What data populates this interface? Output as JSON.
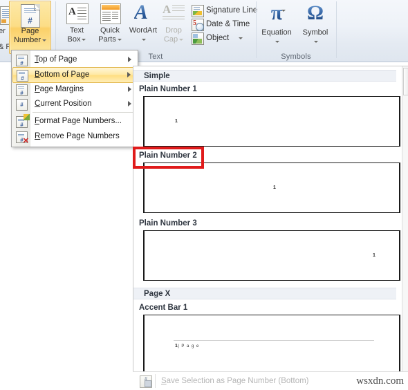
{
  "app": {
    "watermark": "wsxdn.com"
  },
  "ribbon": {
    "partial_button": {
      "label": "er",
      "sublabel": "& F"
    },
    "page_number": {
      "line1": "Page",
      "line2": "Number",
      "icon": "page-number-icon"
    },
    "text_box": {
      "line1": "Text",
      "line2": "Box",
      "icon": "text-box-icon"
    },
    "quick_parts": {
      "line1": "Quick",
      "line2": "Parts",
      "icon": "quick-parts-icon"
    },
    "wordart": {
      "line1": "WordArt",
      "glyph": "A",
      "icon": "wordart-icon"
    },
    "drop_cap": {
      "line1": "Drop",
      "line2": "Cap",
      "icon": "drop-cap-icon"
    },
    "signature_line": {
      "label": "Signature Line",
      "icon": "signature-line-icon"
    },
    "date_time": {
      "label": "Date & Time",
      "icon": "date-time-icon",
      "day": "5"
    },
    "object": {
      "label": "Object",
      "icon": "object-icon"
    },
    "equation": {
      "label": "Equation",
      "glyph": "π",
      "icon": "equation-icon"
    },
    "symbol": {
      "label": "Symbol",
      "glyph": "Ω",
      "icon": "symbol-icon"
    },
    "groups": {
      "text": "Text",
      "symbols": "Symbols"
    }
  },
  "menu": {
    "items": [
      {
        "label": "Top of Page",
        "mnemonic": "T",
        "rest": "op of Page",
        "submenu": true,
        "selected": false,
        "icon": "page-top-icon"
      },
      {
        "label": "Bottom of Page",
        "mnemonic": "B",
        "rest": "ottom of Page",
        "submenu": true,
        "selected": true,
        "icon": "page-bottom-icon"
      },
      {
        "label": "Page Margins",
        "mnemonic": "P",
        "rest": "age Margins",
        "submenu": true,
        "selected": false,
        "icon": "page-margins-icon"
      },
      {
        "label": "Current Position",
        "mnemonic": "C",
        "rest": "urrent Position",
        "submenu": true,
        "selected": false,
        "icon": "current-position-icon"
      },
      {
        "label": "Format Page Numbers...",
        "mnemonic": "F",
        "rest": "ormat Page Numbers...",
        "submenu": false,
        "selected": false,
        "icon": "format-page-numbers-icon"
      },
      {
        "label": "Remove Page Numbers",
        "mnemonic": "R",
        "rest": "emove Page Numbers",
        "submenu": false,
        "selected": false,
        "icon": "remove-page-numbers-icon"
      }
    ]
  },
  "gallery": {
    "sections": [
      {
        "heading": "Simple",
        "items": [
          {
            "title": "Plain Number 1",
            "number": "1",
            "align": "left",
            "highlighted": false
          },
          {
            "title": "Plain Number 2",
            "number": "1",
            "align": "center",
            "highlighted": true
          },
          {
            "title": "Plain Number 3",
            "number": "1",
            "align": "right",
            "highlighted": false
          }
        ]
      },
      {
        "heading": "Page X",
        "items": [
          {
            "title": "Accent Bar 1",
            "number": "1",
            "suffix": "| P a g e",
            "align": "left",
            "highlighted": false
          }
        ]
      }
    ]
  },
  "command_bar": {
    "label": "Save Selection as Page Number (Bottom)",
    "mnemonic": "S",
    "rest": "ave Selection as Page Number (Bottom)",
    "icon": "save-selection-icon"
  },
  "colors": {
    "accent_highlight": "#ffdd80",
    "red_annotation": "#e01b1b",
    "section_header_bg": "#eef1f6",
    "ribbon_bg": "#eef2f8"
  }
}
